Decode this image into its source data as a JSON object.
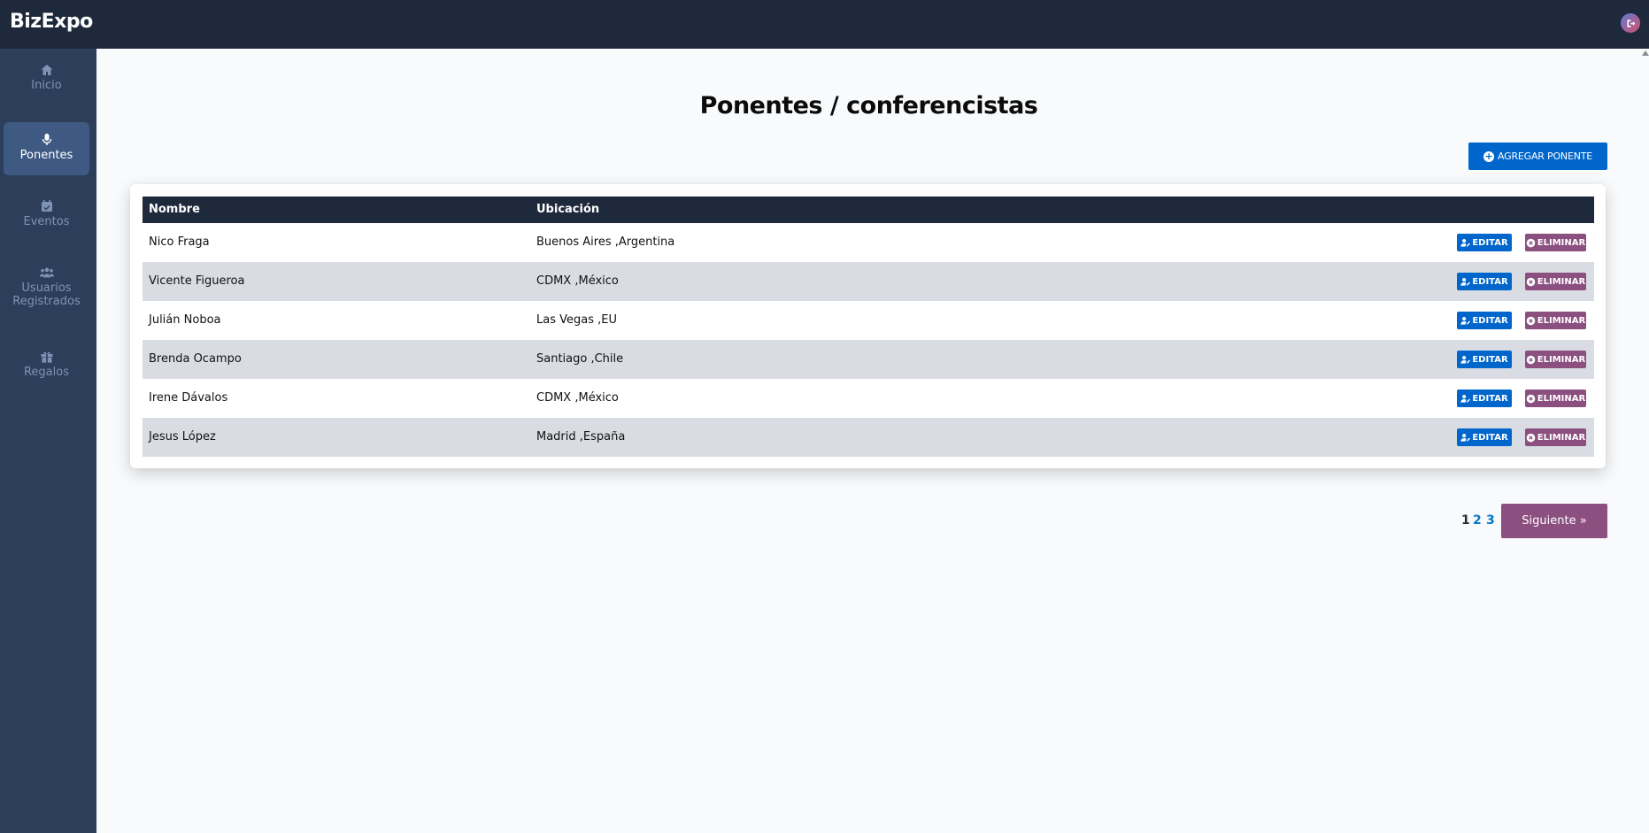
{
  "app": {
    "brand": "BizExpo"
  },
  "sidebar": {
    "items": [
      {
        "label": "Inicio",
        "icon": "home-icon",
        "active": false
      },
      {
        "label": "Ponentes",
        "icon": "microphone-icon",
        "active": true
      },
      {
        "label": "Eventos",
        "icon": "calendar-icon",
        "active": false
      },
      {
        "label": "Usuarios Registrados",
        "icon": "users-icon",
        "active": false
      },
      {
        "label": "Regalos",
        "icon": "gift-icon",
        "active": false
      }
    ]
  },
  "main": {
    "title": "Ponentes / conferencistas",
    "add_button": "AGREGAR PONENTE",
    "table": {
      "headers": [
        "Nombre",
        "Ubicación"
      ],
      "rows": [
        {
          "name": "Nico Fraga",
          "location": "Buenos Aires ,Argentina"
        },
        {
          "name": "Vicente Figueroa",
          "location": "CDMX ,México"
        },
        {
          "name": "Julián Noboa",
          "location": "Las Vegas ,EU"
        },
        {
          "name": "Brenda Ocampo",
          "location": "Santiago ,Chile"
        },
        {
          "name": "Irene Dávalos",
          "location": "CDMX ,México"
        },
        {
          "name": "Jesus López",
          "location": "Madrid ,España"
        }
      ],
      "edit_label": "EDITAR",
      "delete_label": "ELIMINAR"
    },
    "pagination": {
      "pages": [
        "1",
        "2",
        "3"
      ],
      "current": "1",
      "next_label": "Siguiente »"
    }
  },
  "colors": {
    "topbar": "#1e293b",
    "sidebar": "#2d3e5a",
    "primary": "#0066cc",
    "danger": "#8b4f80"
  }
}
